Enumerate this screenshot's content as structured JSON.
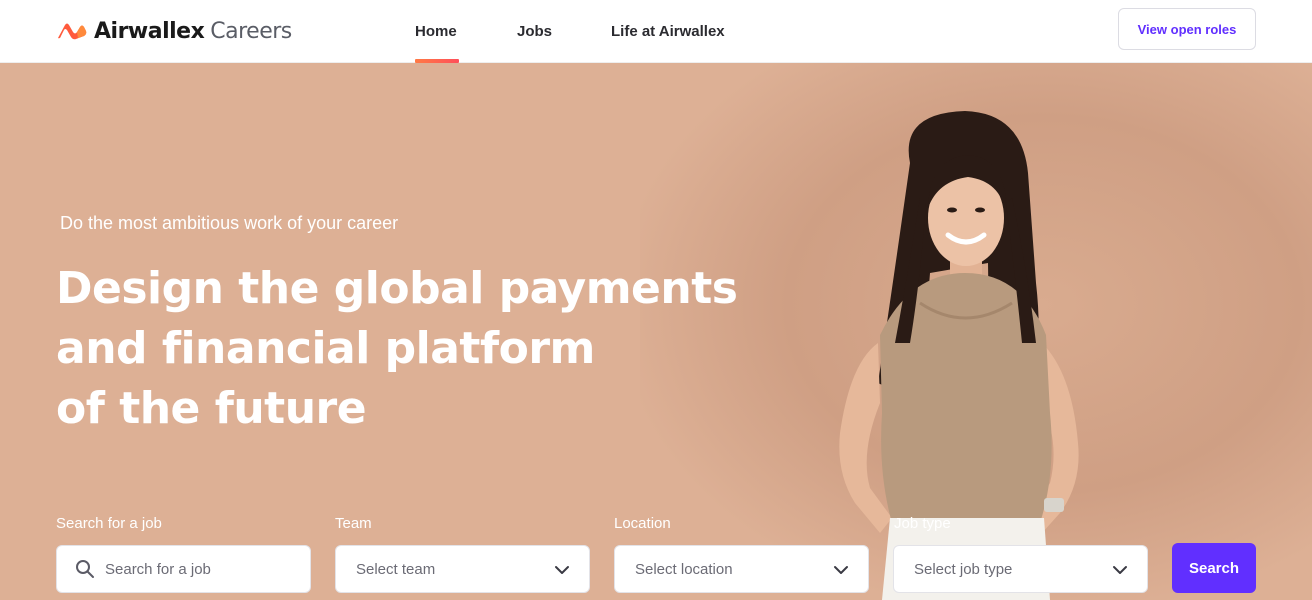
{
  "brand": {
    "name": "Airwallex",
    "sub": "Careers",
    "accent": "#ff5a4f",
    "primary": "#612fff"
  },
  "nav": {
    "items": [
      {
        "label": "Home",
        "active": true
      },
      {
        "label": "Jobs",
        "active": false
      },
      {
        "label": "Life at Airwallex",
        "active": false
      }
    ],
    "cta_label": "View open roles"
  },
  "hero": {
    "eyebrow": "Do the most ambitious work of your career",
    "headline_lines": [
      "Design  the global payments",
      "and financial platform",
      "of the future"
    ],
    "background": "#ddb095"
  },
  "search_form": {
    "job": {
      "label": "Search for a job",
      "placeholder": "Search for a job",
      "icon": "search-icon"
    },
    "team": {
      "label": "Team",
      "placeholder": "Select team"
    },
    "location": {
      "label": "Location",
      "placeholder": "Select location"
    },
    "job_type": {
      "label": "Job type",
      "placeholder": "Select job type"
    },
    "submit_label": "Search"
  }
}
